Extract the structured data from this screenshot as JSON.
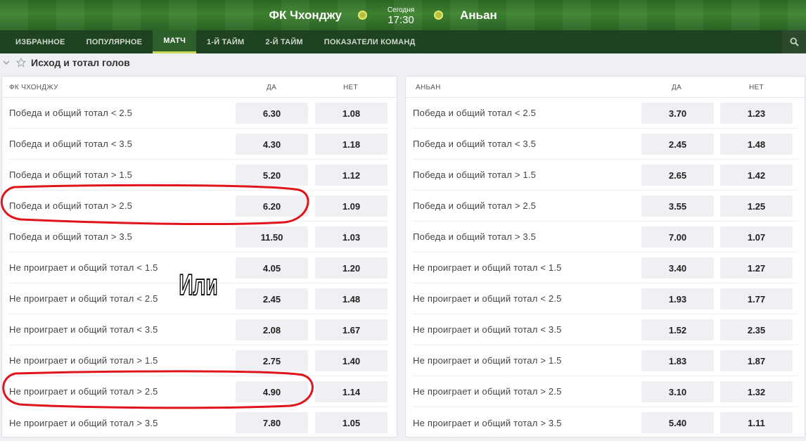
{
  "header": {
    "home_team": "ФК Чхонджу",
    "away_team": "Аньан",
    "day": "Сегодня",
    "time": "17:30"
  },
  "nav": {
    "tabs": [
      {
        "label": "ИЗБРАННОЕ",
        "active": false
      },
      {
        "label": "ПОПУЛЯРНОЕ",
        "active": false
      },
      {
        "label": "МАТЧ",
        "active": true
      },
      {
        "label": "1-Й ТАЙМ",
        "active": false
      },
      {
        "label": "2-Й ТАЙМ",
        "active": false
      },
      {
        "label": "ПОКАЗАТЕЛИ КОМАНД",
        "active": false
      }
    ],
    "search_icon": "search-icon"
  },
  "section": {
    "title": "Исход и тотал голов",
    "collapse_icon": "chevron-down-icon",
    "star_icon": "star-outline-icon"
  },
  "columns": {
    "yes": "ДА",
    "no": "НЕТ"
  },
  "annotation": {
    "text": "Или",
    "circle_color": "#e0151b"
  },
  "home_market": {
    "team": "ФК ЧХОНДЖУ",
    "rows": [
      {
        "label": "Победа и общий тотал < 2.5",
        "yes": "6.30",
        "no": "1.08"
      },
      {
        "label": "Победа и общий тотал < 3.5",
        "yes": "4.30",
        "no": "1.18"
      },
      {
        "label": "Победа и общий тотал > 1.5",
        "yes": "5.20",
        "no": "1.12"
      },
      {
        "label": "Победа и общий тотал > 2.5",
        "yes": "6.20",
        "no": "1.09"
      },
      {
        "label": "Победа и общий тотал > 3.5",
        "yes": "11.50",
        "no": "1.03"
      },
      {
        "label": "Не проиграет и общий тотал < 1.5",
        "yes": "4.05",
        "no": "1.20"
      },
      {
        "label": "Не проиграет и общий тотал < 2.5",
        "yes": "2.45",
        "no": "1.48"
      },
      {
        "label": "Не проиграет и общий тотал < 3.5",
        "yes": "2.08",
        "no": "1.67"
      },
      {
        "label": "Не проиграет и общий тотал > 1.5",
        "yes": "2.75",
        "no": "1.40"
      },
      {
        "label": "Не проиграет и общий тотал > 2.5",
        "yes": "4.90",
        "no": "1.14"
      },
      {
        "label": "Не проиграет и общий тотал > 3.5",
        "yes": "7.80",
        "no": "1.05"
      }
    ]
  },
  "away_market": {
    "team": "АНЬАН",
    "rows": [
      {
        "label": "Победа и общий тотал < 2.5",
        "yes": "3.70",
        "no": "1.23"
      },
      {
        "label": "Победа и общий тотал < 3.5",
        "yes": "2.45",
        "no": "1.48"
      },
      {
        "label": "Победа и общий тотал > 1.5",
        "yes": "2.65",
        "no": "1.42"
      },
      {
        "label": "Победа и общий тотал > 2.5",
        "yes": "3.55",
        "no": "1.25"
      },
      {
        "label": "Победа и общий тотал > 3.5",
        "yes": "7.00",
        "no": "1.07"
      },
      {
        "label": "Не проиграет и общий тотал < 1.5",
        "yes": "3.40",
        "no": "1.27"
      },
      {
        "label": "Не проиграет и общий тотал < 2.5",
        "yes": "1.93",
        "no": "1.77"
      },
      {
        "label": "Не проиграет и общий тотал < 3.5",
        "yes": "1.52",
        "no": "2.35"
      },
      {
        "label": "Не проиграет и общий тотал > 1.5",
        "yes": "1.83",
        "no": "1.87"
      },
      {
        "label": "Не проиграет и общий тотал > 2.5",
        "yes": "3.10",
        "no": "1.32"
      },
      {
        "label": "Не проиграет и общий тотал > 3.5",
        "yes": "5.40",
        "no": "1.11"
      }
    ]
  }
}
